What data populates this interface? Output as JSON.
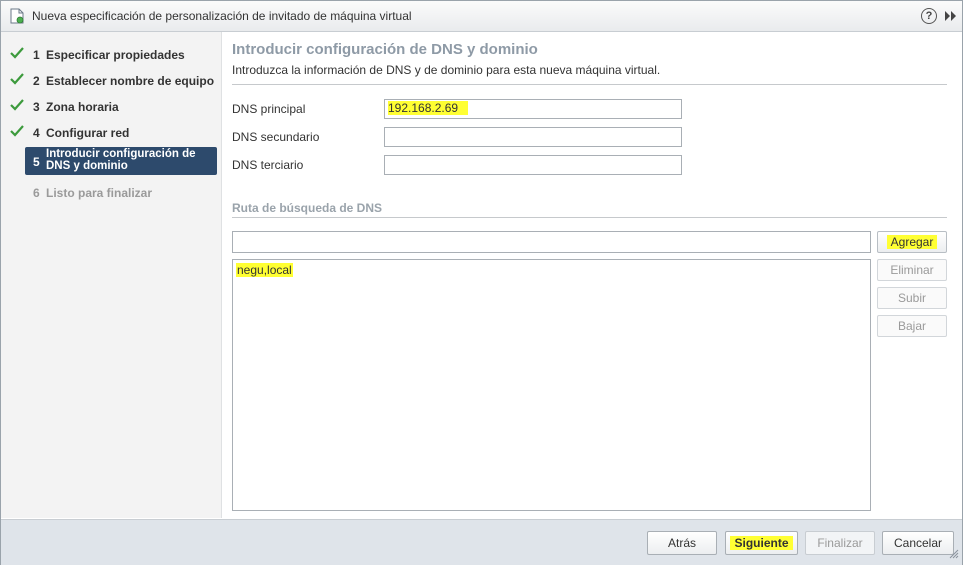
{
  "window": {
    "title": "Nueva especificación de personalización de invitado de máquina virtual",
    "help_glyph": "?"
  },
  "steps": [
    {
      "num": "1",
      "label": "Especificar propiedades",
      "status": "done"
    },
    {
      "num": "2",
      "label": "Establecer nombre de equipo",
      "status": "done"
    },
    {
      "num": "3",
      "label": "Zona horaria",
      "status": "done"
    },
    {
      "num": "4",
      "label": "Configurar red",
      "status": "done"
    },
    {
      "num": "5",
      "label": "Introducir configuración de DNS y dominio",
      "status": "current"
    },
    {
      "num": "6",
      "label": "Listo para finalizar",
      "status": "pending"
    }
  ],
  "page": {
    "title": "Introducir configuración de DNS y dominio",
    "description": "Introduzca la información de DNS y de dominio para esta nueva máquina virtual."
  },
  "dns": {
    "primary_label": "DNS principal",
    "primary_value": "192.168.2.69",
    "secondary_label": "DNS secundario",
    "secondary_value": "",
    "tertiary_label": "DNS terciario",
    "tertiary_value": ""
  },
  "search_path": {
    "section_title": "Ruta de búsqueda de DNS",
    "input_value": "",
    "items": [
      "negu,local"
    ],
    "buttons": {
      "add": "Agregar",
      "remove": "Eliminar",
      "up": "Subir",
      "down": "Bajar"
    }
  },
  "footer": {
    "back": "Atrás",
    "next": "Siguiente",
    "finish": "Finalizar",
    "cancel": "Cancelar"
  },
  "colors": {
    "current_step_bg": "#2d4a6c",
    "check_green": "#3c9a3c",
    "highlight": "#ffff33",
    "footer_bg": "#dfe4ea"
  }
}
